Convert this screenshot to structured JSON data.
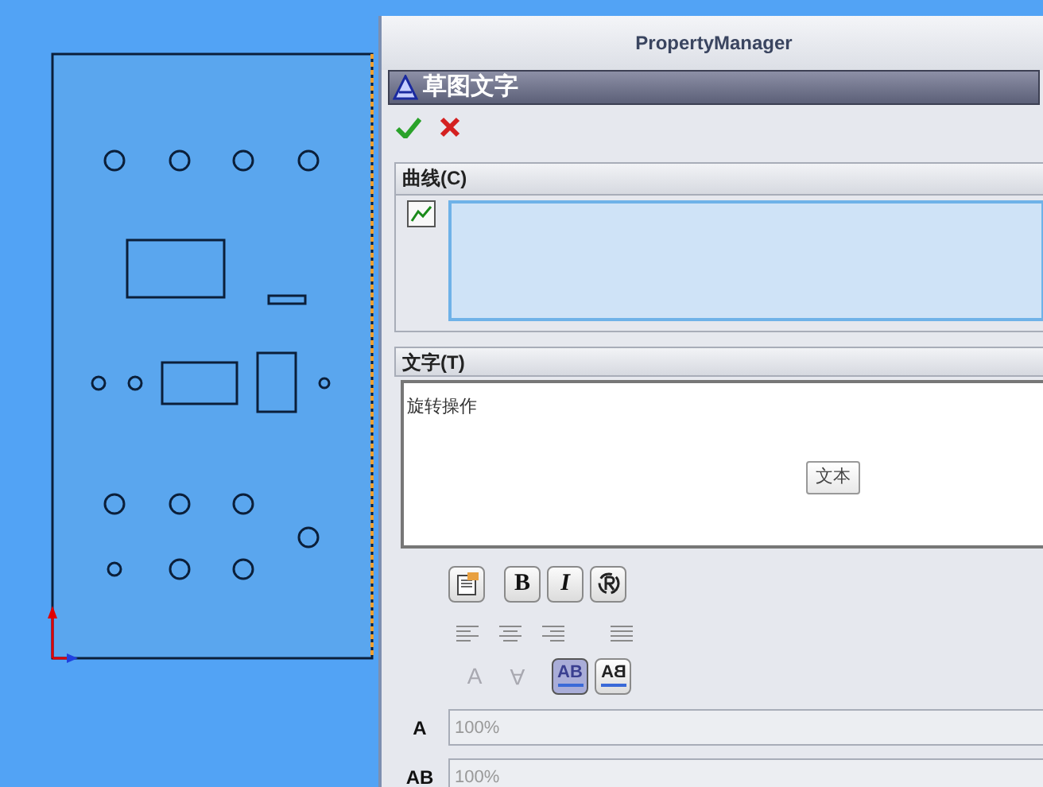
{
  "window": {
    "title": "PropertyManager"
  },
  "feature": {
    "title": "草图文字"
  },
  "actions": [
    {
      "kind": "ok"
    },
    {
      "kind": "cancel"
    }
  ],
  "curves": {
    "title": "曲线(C)"
  },
  "text_section": {
    "title": "文字(T)",
    "value": "旋转操作",
    "tooltip": "文本"
  },
  "format_buttons": [
    {
      "kind": "font"
    },
    {
      "kind": "bold",
      "label": "B"
    },
    {
      "kind": "italic",
      "label": "I"
    },
    {
      "kind": "rotate"
    }
  ],
  "align_buttons": [
    {
      "kind": "left",
      "selected": false
    },
    {
      "kind": "center",
      "selected": false
    },
    {
      "kind": "right",
      "selected": false
    },
    {
      "kind": "justify",
      "selected": false
    }
  ],
  "flip_buttons": [
    {
      "kind": "flip-vertical",
      "label": "A",
      "disabled": true
    },
    {
      "kind": "flip-upside",
      "label": "A",
      "disabled": true
    }
  ],
  "direction_buttons": [
    {
      "label": "AB",
      "kind": "ltr",
      "selected": true
    },
    {
      "label": "BA",
      "kind": "rtl",
      "selected": false
    }
  ],
  "fields": [
    {
      "icon_label": "A",
      "value": "100%",
      "disabled": true
    },
    {
      "icon_label": "AB",
      "value": "100%",
      "disabled": true
    }
  ]
}
